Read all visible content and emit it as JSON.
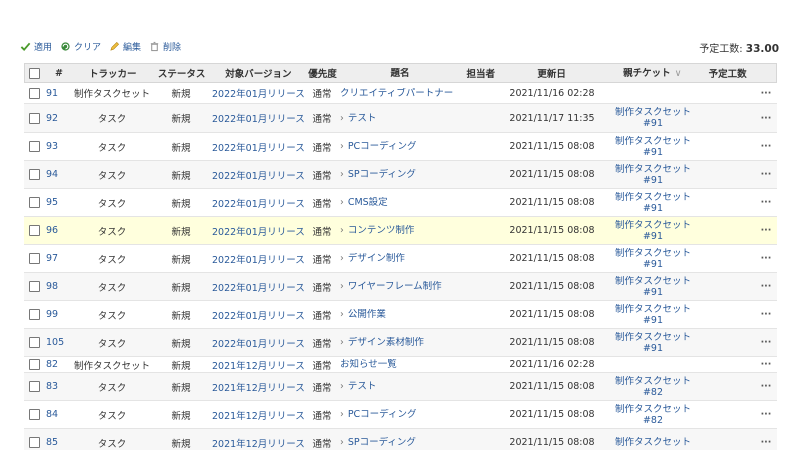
{
  "toolbar": {
    "apply": "適用",
    "clear": "クリア",
    "edit": "編集",
    "delete": "削除"
  },
  "totals": {
    "label": "予定工数:",
    "value": "33.00"
  },
  "headers": {
    "id": "#",
    "tracker": "トラッカー",
    "status": "ステータス",
    "version": "対象バージョン",
    "priority": "優先度",
    "subject": "題名",
    "assignee": "担当者",
    "updated": "更新日",
    "parent": "親チケット",
    "estimated": "予定工数",
    "sort_icon": "chevron-down-icon"
  },
  "rows": [
    {
      "id": "91",
      "tracker": "制作タスクセット",
      "status": "新規",
      "version": "2022年01月リリース",
      "priority": "通常",
      "subject": "クリエイティブパートナー",
      "child": false,
      "updated": "2021/11/16 02:28",
      "parent": "",
      "more": "···"
    },
    {
      "id": "92",
      "tracker": "タスク",
      "status": "新規",
      "version": "2022年01月リリース",
      "priority": "通常",
      "subject": "テスト",
      "child": true,
      "updated": "2021/11/17 11:35",
      "parent": "制作タスクセット #91",
      "more": "···"
    },
    {
      "id": "93",
      "tracker": "タスク",
      "status": "新規",
      "version": "2022年01月リリース",
      "priority": "通常",
      "subject": "PCコーディング",
      "child": true,
      "updated": "2021/11/15 08:08",
      "parent": "制作タスクセット #91",
      "more": "···"
    },
    {
      "id": "94",
      "tracker": "タスク",
      "status": "新規",
      "version": "2022年01月リリース",
      "priority": "通常",
      "subject": "SPコーディング",
      "child": true,
      "updated": "2021/11/15 08:08",
      "parent": "制作タスクセット #91",
      "more": "···"
    },
    {
      "id": "95",
      "tracker": "タスク",
      "status": "新規",
      "version": "2022年01月リリース",
      "priority": "通常",
      "subject": "CMS設定",
      "child": true,
      "updated": "2021/11/15 08:08",
      "parent": "制作タスクセット #91",
      "more": "···"
    },
    {
      "id": "96",
      "tracker": "タスク",
      "status": "新規",
      "version": "2022年01月リリース",
      "priority": "通常",
      "subject": "コンテンツ制作",
      "child": true,
      "updated": "2021/11/15 08:08",
      "parent": "制作タスクセット #91",
      "more": "···"
    },
    {
      "id": "97",
      "tracker": "タスク",
      "status": "新規",
      "version": "2022年01月リリース",
      "priority": "通常",
      "subject": "デザイン制作",
      "child": true,
      "updated": "2021/11/15 08:08",
      "parent": "制作タスクセット #91",
      "more": "···"
    },
    {
      "id": "98",
      "tracker": "タスク",
      "status": "新規",
      "version": "2022年01月リリース",
      "priority": "通常",
      "subject": "ワイヤーフレーム制作",
      "child": true,
      "updated": "2021/11/15 08:08",
      "parent": "制作タスクセット #91",
      "more": "···"
    },
    {
      "id": "99",
      "tracker": "タスク",
      "status": "新規",
      "version": "2022年01月リリース",
      "priority": "通常",
      "subject": "公開作業",
      "child": true,
      "updated": "2021/11/15 08:08",
      "parent": "制作タスクセット #91",
      "more": "···"
    },
    {
      "id": "105",
      "tracker": "タスク",
      "status": "新規",
      "version": "2022年01月リリース",
      "priority": "通常",
      "subject": "デザイン素材制作",
      "child": true,
      "updated": "2021/11/15 08:08",
      "parent": "制作タスクセット #91",
      "more": "···"
    },
    {
      "id": "82",
      "tracker": "制作タスクセット",
      "status": "新規",
      "version": "2021年12月リリース",
      "priority": "通常",
      "subject": "お知らせ一覧",
      "child": false,
      "updated": "2021/11/16 02:28",
      "parent": "",
      "more": "···"
    },
    {
      "id": "83",
      "tracker": "タスク",
      "status": "新規",
      "version": "2021年12月リリース",
      "priority": "通常",
      "subject": "テスト",
      "child": true,
      "updated": "2021/11/15 08:08",
      "parent": "制作タスクセット #82",
      "more": "···"
    },
    {
      "id": "84",
      "tracker": "タスク",
      "status": "新規",
      "version": "2021年12月リリース",
      "priority": "通常",
      "subject": "PCコーディング",
      "child": true,
      "updated": "2021/11/15 08:08",
      "parent": "制作タスクセット #82",
      "more": "···"
    },
    {
      "id": "85",
      "tracker": "タスク",
      "status": "新規",
      "version": "2021年12月リリース",
      "priority": "通常",
      "subject": "SPコーディング",
      "child": true,
      "updated": "2021/11/15 08:08",
      "parent": "制作タスクセット",
      "more": "···"
    }
  ],
  "colors": {
    "link": "#2a5a9a",
    "highlight_row": "#ffffdd",
    "header_bg": "#eeeeee",
    "apply_icon": "#4a9a2a",
    "clear_icon": "#3a8a3a",
    "edit_icon": "#d8a020",
    "delete_icon": "#888888"
  }
}
